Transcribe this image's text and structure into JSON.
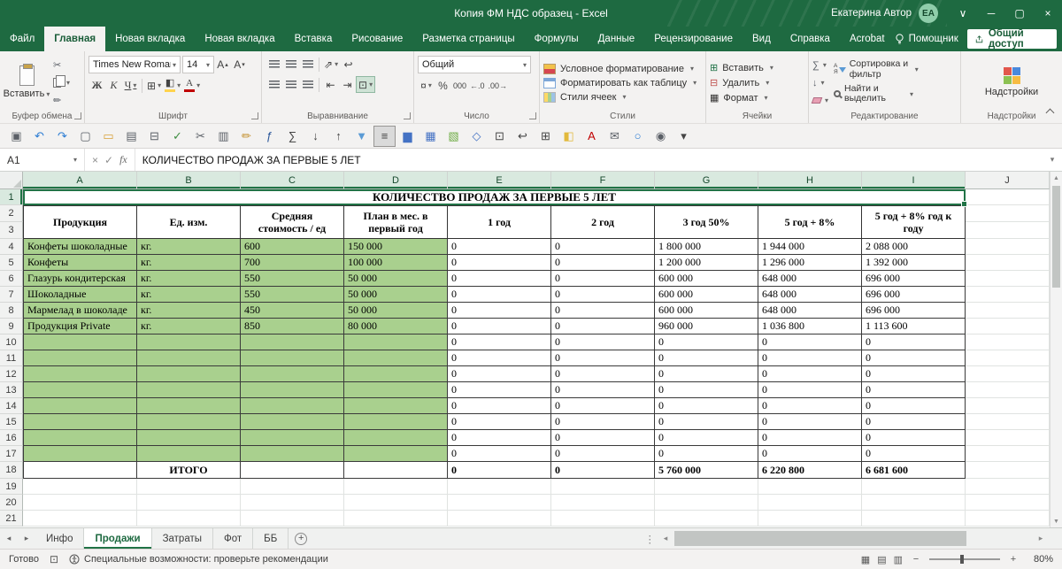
{
  "title_bar": {
    "title": "Копия ФМ НДС образец  -  Excel",
    "user_name": "Екатерина Автор",
    "user_initials": "ЕА"
  },
  "ribbon_tabs": [
    {
      "name": "file",
      "label": "Файл",
      "active": false
    },
    {
      "name": "home",
      "label": "Главная",
      "active": true
    },
    {
      "name": "new-tab-1",
      "label": "Новая вкладка",
      "active": false
    },
    {
      "name": "new-tab-2",
      "label": "Новая вкладка",
      "active": false
    },
    {
      "name": "insert",
      "label": "Вставка",
      "active": false
    },
    {
      "name": "draw",
      "label": "Рисование",
      "active": false
    },
    {
      "name": "page-layout",
      "label": "Разметка страницы",
      "active": false
    },
    {
      "name": "formulas",
      "label": "Формулы",
      "active": false
    },
    {
      "name": "data",
      "label": "Данные",
      "active": false
    },
    {
      "name": "review",
      "label": "Рецензирование",
      "active": false
    },
    {
      "name": "view",
      "label": "Вид",
      "active": false
    },
    {
      "name": "help",
      "label": "Справка",
      "active": false
    },
    {
      "name": "acrobat",
      "label": "Acrobat",
      "active": false
    }
  ],
  "tab_bar_right": {
    "assistant_label": "Помощник",
    "share_label": "Общий доступ"
  },
  "ribbon": {
    "clipboard": {
      "paste_label": "Вставить",
      "group_label": "Буфер обмена"
    },
    "font": {
      "family": "Times New Roman",
      "size": "14",
      "bold": "Ж",
      "italic": "К",
      "underline": "Ч",
      "group_label": "Шрифт"
    },
    "alignment": {
      "group_label": "Выравнивание"
    },
    "number": {
      "format": "Общий",
      "group_label": "Число"
    },
    "styles": {
      "conditional": "Условное форматирование",
      "format_table": "Форматировать как таблицу",
      "cell_styles": "Стили ячеек",
      "group_label": "Стили"
    },
    "cells": {
      "insert": "Вставить",
      "delete": "Удалить",
      "format": "Формат",
      "group_label": "Ячейки"
    },
    "editing": {
      "sort": "Сортировка и фильтр",
      "find": "Найти и выделить",
      "group_label": "Редактирование"
    },
    "addins": {
      "button": "Надстройки",
      "group_label": "Надстройки"
    }
  },
  "quick_access_icons": [
    {
      "name": "save",
      "glyph": "▣",
      "color": "#5a5f66"
    },
    {
      "name": "undo",
      "glyph": "↶",
      "color": "#2b7cd3"
    },
    {
      "name": "redo",
      "glyph": "↷",
      "color": "#2b7cd3"
    },
    {
      "name": "new-document",
      "glyph": "▢",
      "color": "#5a5f66"
    },
    {
      "name": "open-folder",
      "glyph": "▭",
      "color": "#d8a13a"
    },
    {
      "name": "quick-print",
      "glyph": "▤",
      "color": "#5a5f66"
    },
    {
      "name": "print-preview",
      "glyph": "⊟",
      "color": "#5a5f66"
    },
    {
      "name": "spelling-check",
      "glyph": "✓",
      "color": "#3e8e41"
    },
    {
      "name": "cut",
      "glyph": "✂",
      "color": "#5a5f66"
    },
    {
      "name": "copy",
      "glyph": "▥",
      "color": "#5a5f66"
    },
    {
      "name": "format-painter",
      "glyph": "✏",
      "color": "#c28e2a"
    },
    {
      "name": "insert-function",
      "glyph": "ƒ",
      "color": "#2b579a"
    },
    {
      "name": "autosum",
      "glyph": "∑",
      "color": "#444444"
    },
    {
      "name": "sort-ascending",
      "glyph": "↓",
      "color": "#444444"
    },
    {
      "name": "sort-descending",
      "glyph": "↑",
      "color": "#444444"
    },
    {
      "name": "filter",
      "glyph": "▼",
      "color": "#5b9bd5"
    },
    {
      "name": "align-center",
      "glyph": "≡",
      "color": "#444444",
      "active": true
    },
    {
      "name": "chart",
      "glyph": "▆",
      "color": "#4472c4"
    },
    {
      "name": "insert-table",
      "glyph": "▦",
      "color": "#4472c4"
    },
    {
      "name": "pivot-table",
      "glyph": "▧",
      "color": "#70ad47"
    },
    {
      "name": "freeze-panes",
      "glyph": "◇",
      "color": "#4472c4"
    },
    {
      "name": "merge-center",
      "glyph": "⊡",
      "color": "#444444"
    },
    {
      "name": "wrap-text",
      "glyph": "↩",
      "color": "#444444"
    },
    {
      "name": "borders",
      "glyph": "⊞",
      "color": "#444444"
    },
    {
      "name": "fill-color",
      "glyph": "◧",
      "color": "#e2b93b"
    },
    {
      "name": "font-color",
      "glyph": "А",
      "color": "#c00000"
    },
    {
      "name": "insert-comment",
      "glyph": "✉",
      "color": "#5a5f66"
    },
    {
      "name": "hyperlink",
      "glyph": "○",
      "color": "#2b7cd3"
    },
    {
      "name": "camera",
      "glyph": "◉",
      "color": "#5a5f66"
    },
    {
      "name": "customize-quick-access",
      "glyph": "▾",
      "color": "#444444"
    }
  ],
  "formula_bar": {
    "name_box": "A1",
    "formula": "КОЛИЧЕСТВО ПРОДАЖ ЗА ПЕРВЫЕ 5 ЛЕТ"
  },
  "grid": {
    "columns": [
      "A",
      "B",
      "C",
      "D",
      "E",
      "F",
      "G",
      "H",
      "I",
      "J"
    ],
    "title": "КОЛИЧЕСТВО ПРОДАЖ ЗА ПЕРВЫЕ 5 ЛЕТ",
    "header_row": [
      "Продукция",
      "Ед. изм.",
      "Средняя стоимость / ед",
      "План в мес. в первый год",
      "1 год",
      "2 год",
      "3 год 50%",
      "5 год + 8%",
      "5 год + 8% год к году"
    ],
    "data_rows": [
      [
        "Конфеты шоколадные",
        "кг.",
        "600",
        "150 000",
        "0",
        "0",
        "1 800 000",
        "1 944 000",
        "2 088 000"
      ],
      [
        "Конфеты",
        "кг.",
        "700",
        "100 000",
        "0",
        "0",
        "1 200 000",
        "1 296 000",
        "1 392 000"
      ],
      [
        "Глазурь кондитерская",
        "кг.",
        "550",
        "50 000",
        "0",
        "0",
        "600 000",
        "648 000",
        "696 000"
      ],
      [
        "Шоколадные",
        "кг.",
        "550",
        "50 000",
        "0",
        "0",
        "600 000",
        "648 000",
        "696 000"
      ],
      [
        "Мармелад в шоколаде",
        "кг.",
        "450",
        "50 000",
        "0",
        "0",
        "600 000",
        "648 000",
        "696 000"
      ],
      [
        "Продукция Private",
        "кг.",
        "850",
        "80 000",
        "0",
        "0",
        "960 000",
        "1 036 800",
        "1 113 600"
      ],
      [
        "",
        "",
        "",
        "",
        "0",
        "0",
        "0",
        "0",
        "0"
      ],
      [
        "",
        "",
        "",
        "",
        "0",
        "0",
        "0",
        "0",
        "0"
      ],
      [
        "",
        "",
        "",
        "",
        "0",
        "0",
        "0",
        "0",
        "0"
      ],
      [
        "",
        "",
        "",
        "",
        "0",
        "0",
        "0",
        "0",
        "0"
      ],
      [
        "",
        "",
        "",
        "",
        "0",
        "0",
        "0",
        "0",
        "0"
      ],
      [
        "",
        "",
        "",
        "",
        "0",
        "0",
        "0",
        "0",
        "0"
      ],
      [
        "",
        "",
        "",
        "",
        "0",
        "0",
        "0",
        "0",
        "0"
      ],
      [
        "",
        "",
        "",
        "",
        "0",
        "0",
        "0",
        "0",
        "0"
      ]
    ],
    "total_row": [
      "",
      "ИТОГО",
      "",
      "",
      "0",
      "0",
      "5 760 000",
      "6 220 800",
      "6 681 600"
    ]
  },
  "sheet_tabs": [
    {
      "name": "info",
      "label": "Инфо",
      "active": false
    },
    {
      "name": "sales",
      "label": "Продажи",
      "active": true
    },
    {
      "name": "costs",
      "label": "Затраты",
      "active": false
    },
    {
      "name": "fot",
      "label": "Фот",
      "active": false
    },
    {
      "name": "bb",
      "label": "ББ",
      "active": false
    }
  ],
  "status_bar": {
    "mode": "Готово",
    "accessibility": "Специальные возможности: проверьте рекомендации",
    "zoom": "80%"
  }
}
